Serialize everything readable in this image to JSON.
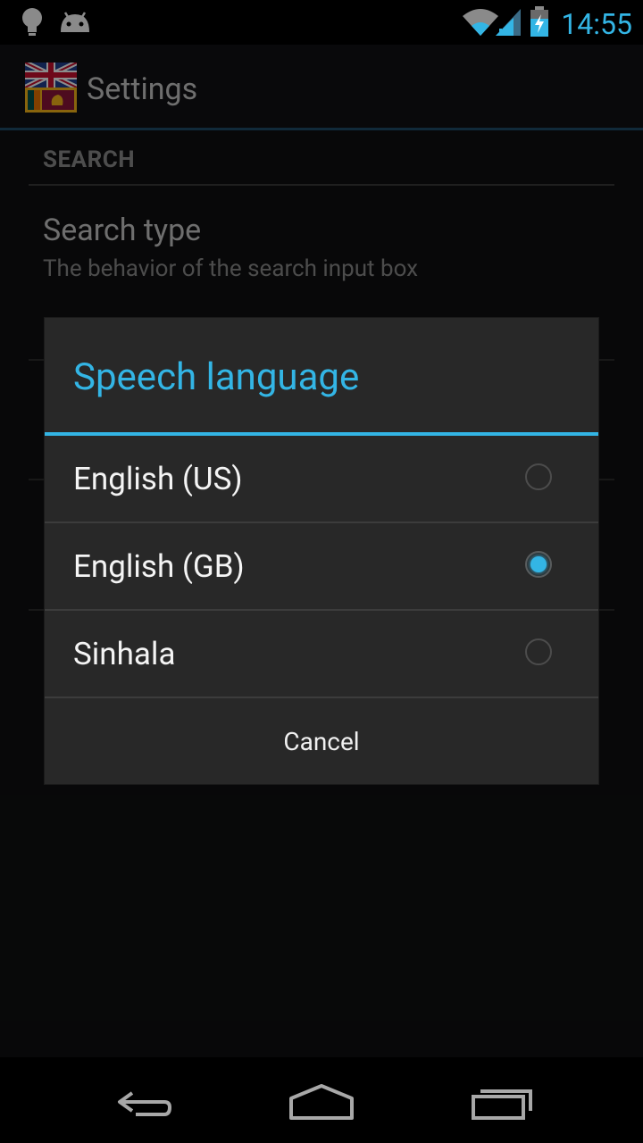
{
  "status_bar": {
    "time": "14:55",
    "icons": [
      "lightbulb-icon",
      "android-icon",
      "wifi-icon",
      "signal-icon",
      "battery-charging-icon"
    ]
  },
  "action_bar": {
    "title": "Settings",
    "app_icon": "flags-icon"
  },
  "settings": {
    "section_header": "SEARCH",
    "search_type": {
      "title": "Search type",
      "summary": "The behavior of the search input box"
    }
  },
  "dialog": {
    "title": "Speech language",
    "options": [
      {
        "label": "English (US)",
        "checked": false
      },
      {
        "label": "English (GB)",
        "checked": true
      },
      {
        "label": "Sinhala",
        "checked": false
      }
    ],
    "cancel_label": "Cancel"
  },
  "nav_bar": {
    "buttons": [
      "back-icon",
      "home-icon",
      "recents-icon"
    ]
  },
  "colors": {
    "accent": "#33b5e5",
    "dialog_bg": "#282828"
  }
}
